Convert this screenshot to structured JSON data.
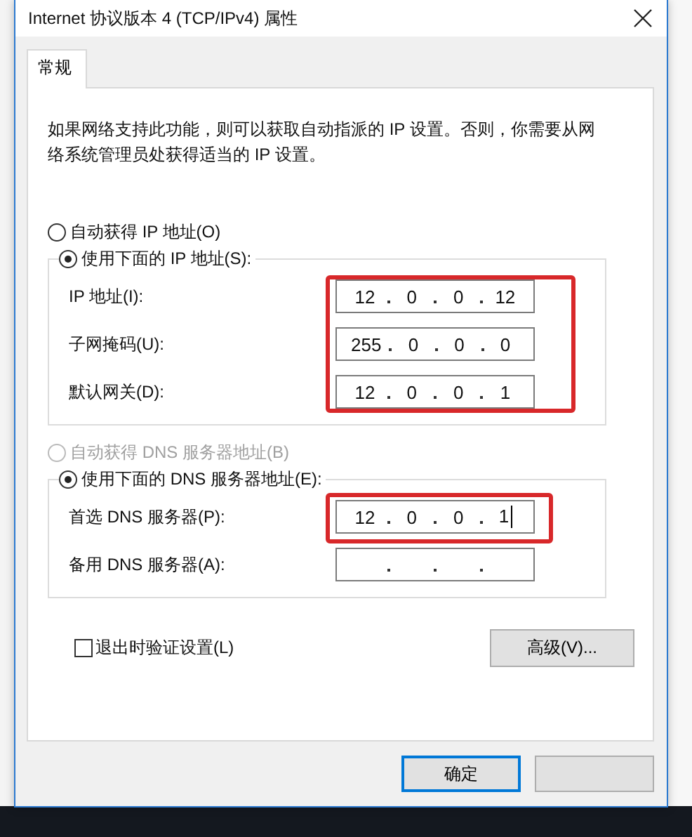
{
  "window": {
    "title": "Internet 协议版本 4 (TCP/IPv4) 属性"
  },
  "tabs": [
    {
      "label": "常规",
      "selected": true
    }
  ],
  "description": "如果网络支持此功能，则可以获取自动指派的 IP 设置。否则，你需要从网络系统管理员处获得适当的 IP 设置。",
  "sections": [
    {
      "auto_option": {
        "label": "自动获得 IP 地址(O)",
        "selected": false,
        "disabled": false
      },
      "manual_option": {
        "label": "使用下面的 IP 地址(S):",
        "selected": true,
        "disabled": false
      },
      "fields": [
        {
          "label": "IP 地址(I):",
          "octets": [
            "12",
            "0",
            "0",
            "12"
          ],
          "highlighted": true,
          "focused": false
        },
        {
          "label": "子网掩码(U):",
          "octets": [
            "255",
            "0",
            "0",
            "0"
          ],
          "highlighted": true,
          "focused": false
        },
        {
          "label": "默认网关(D):",
          "octets": [
            "12",
            "0",
            "0",
            "1"
          ],
          "highlighted": true,
          "focused": false
        }
      ]
    },
    {
      "auto_option": {
        "label": "自动获得 DNS 服务器地址(B)",
        "selected": false,
        "disabled": true
      },
      "manual_option": {
        "label": "使用下面的 DNS 服务器地址(E):",
        "selected": true,
        "disabled": false
      },
      "fields": [
        {
          "label": "首选 DNS 服务器(P):",
          "octets": [
            "12",
            "0",
            "0",
            "1"
          ],
          "highlighted": true,
          "focused": true
        },
        {
          "label": "备用 DNS 服务器(A):",
          "highlighted": false,
          "focused": false
        }
      ]
    }
  ],
  "validate_checkbox": {
    "label": "退出时验证设置(L)",
    "checked": false
  },
  "advanced_button": "高级(V)...",
  "buttons": [
    {
      "label": "确定",
      "default": true
    },
    {
      "default": false
    }
  ]
}
